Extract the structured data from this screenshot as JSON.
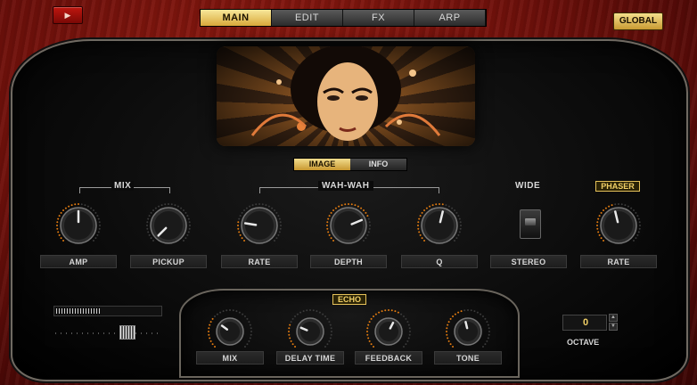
{
  "header": {
    "menu_glyph": "▶",
    "tabs": [
      "MAIN",
      "EDIT",
      "FX",
      "ARP"
    ],
    "active_tab": "MAIN",
    "global_label": "GLOBAL"
  },
  "image_panel": {
    "tabs": [
      "IMAGE",
      "INFO"
    ],
    "active_tab": "IMAGE"
  },
  "sections": {
    "mix": "MIX",
    "wahwah": "WAH-WAH",
    "wide": "WIDE",
    "phaser": "PHASER",
    "echo": "ECHO"
  },
  "knobs": [
    {
      "label": "AMP",
      "value": 0.5
    },
    {
      "label": "PICKUP",
      "value": 0.0
    },
    {
      "label": "RATE",
      "value": 0.2
    },
    {
      "label": "DEPTH",
      "value": 0.75
    },
    {
      "label": "Q",
      "value": 0.55
    },
    {
      "label": "RATE",
      "value": 0.45
    }
  ],
  "wide_switch": {
    "label": "STEREO",
    "state": "on"
  },
  "echo_knobs": [
    {
      "label": "MIX",
      "value": 0.3
    },
    {
      "label": "DELAY TIME",
      "value": 0.25
    },
    {
      "label": "FEEDBACK",
      "value": 0.6
    },
    {
      "label": "TONE",
      "value": 0.45
    }
  ],
  "meter_level": 0.42,
  "slider_position": 0.72,
  "octave": {
    "value": "0",
    "label": "OCTAVE",
    "up_glyph": "▲",
    "down_glyph": "▼"
  },
  "colors": {
    "accent": "#f0cf66",
    "ring": "#e07a10",
    "panel": "#0b0b0b"
  }
}
